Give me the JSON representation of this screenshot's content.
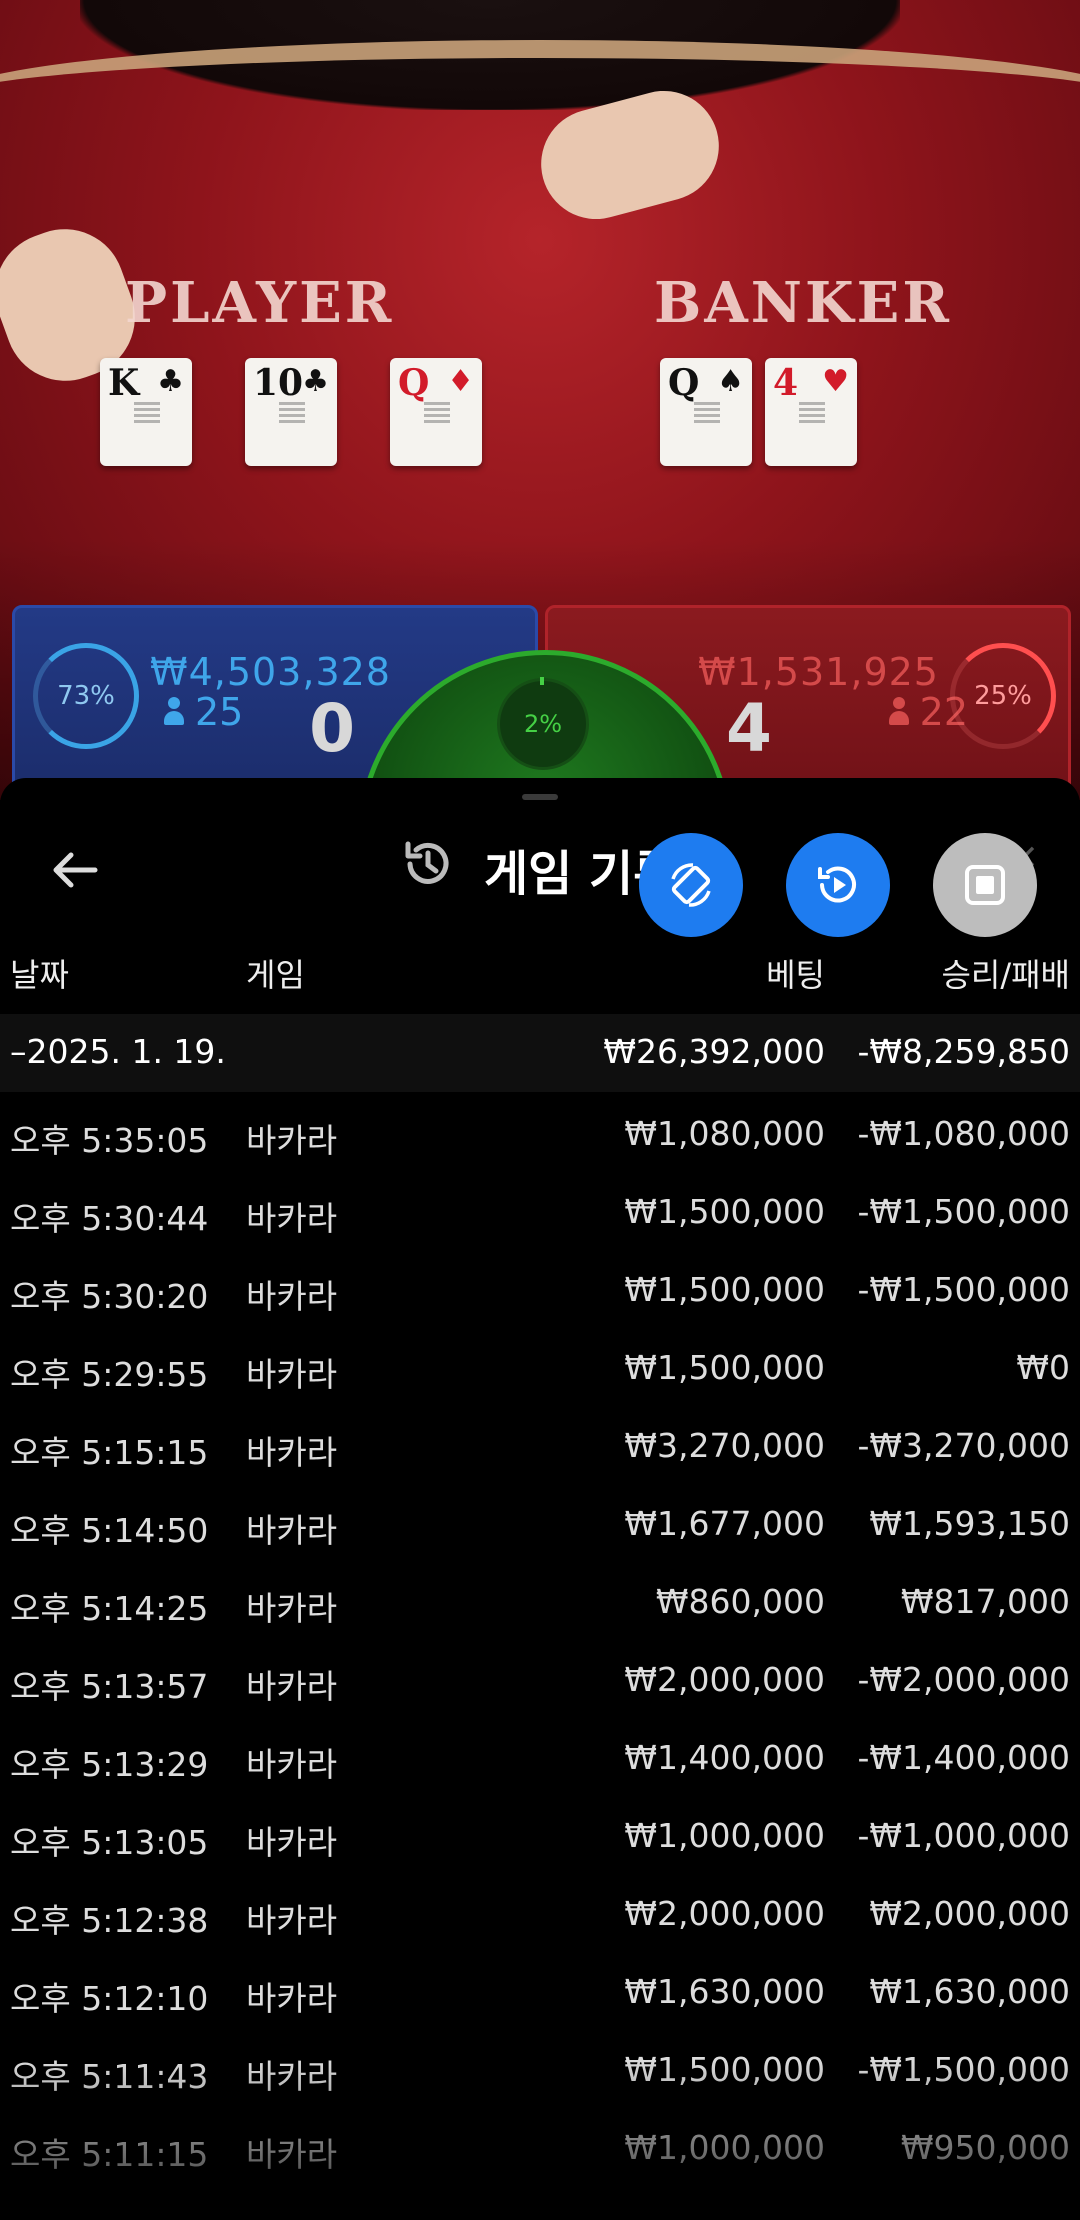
{
  "video": {
    "player_label": "PLAYER",
    "banker_label": "BANKER",
    "player_cards": [
      {
        "rank": "K",
        "suit": "♣",
        "color": "black"
      },
      {
        "rank": "10",
        "suit": "♣",
        "color": "black"
      },
      {
        "rank": "Q",
        "suit": "♦",
        "color": "red"
      }
    ],
    "banker_cards": [
      {
        "rank": "Q",
        "suit": "♠",
        "color": "black"
      },
      {
        "rank": "4",
        "suit": "♥",
        "color": "red"
      }
    ]
  },
  "bets": {
    "player": {
      "percent": "73%",
      "amount": "₩4,503,328",
      "count": "25",
      "score": "0",
      "color": "#3fa6ea"
    },
    "tie": {
      "percent": "2%",
      "color": "#45d045"
    },
    "banker": {
      "percent": "25%",
      "amount": "₩1,531,925",
      "count": "22",
      "score": "4",
      "color": "#d44a4a"
    }
  },
  "sheet": {
    "title": "게임 기록",
    "icons": {
      "back": "arrow-left-icon",
      "history": "history-clock-icon",
      "fab1": "rotate-screen-icon",
      "fab2": "replay-play-icon",
      "fab3": "stop-icon"
    },
    "columns": {
      "date": "날짜",
      "game": "게임",
      "bet": "베팅",
      "win": "승리/패배"
    },
    "summary": {
      "date": "–2025. 1. 19.",
      "bet": "₩26,392,000",
      "win": "-₩8,259,850"
    },
    "rows": [
      {
        "time": "오후 5:35:05",
        "game": "바카라",
        "bet": "₩1,080,000",
        "win": "-₩1,080,000"
      },
      {
        "time": "오후 5:30:44",
        "game": "바카라",
        "bet": "₩1,500,000",
        "win": "-₩1,500,000"
      },
      {
        "time": "오후 5:30:20",
        "game": "바카라",
        "bet": "₩1,500,000",
        "win": "-₩1,500,000"
      },
      {
        "time": "오후 5:29:55",
        "game": "바카라",
        "bet": "₩1,500,000",
        "win": "₩0"
      },
      {
        "time": "오후 5:15:15",
        "game": "바카라",
        "bet": "₩3,270,000",
        "win": "-₩3,270,000"
      },
      {
        "time": "오후 5:14:50",
        "game": "바카라",
        "bet": "₩1,677,000",
        "win": "₩1,593,150"
      },
      {
        "time": "오후 5:14:25",
        "game": "바카라",
        "bet": "₩860,000",
        "win": "₩817,000"
      },
      {
        "time": "오후 5:13:57",
        "game": "바카라",
        "bet": "₩2,000,000",
        "win": "-₩2,000,000"
      },
      {
        "time": "오후 5:13:29",
        "game": "바카라",
        "bet": "₩1,400,000",
        "win": "-₩1,400,000"
      },
      {
        "time": "오후 5:13:05",
        "game": "바카라",
        "bet": "₩1,000,000",
        "win": "-₩1,000,000"
      },
      {
        "time": "오후 5:12:38",
        "game": "바카라",
        "bet": "₩2,000,000",
        "win": "₩2,000,000"
      },
      {
        "time": "오후 5:12:10",
        "game": "바카라",
        "bet": "₩1,630,000",
        "win": "₩1,630,000"
      },
      {
        "time": "오후 5:11:43",
        "game": "바카라",
        "bet": "₩1,500,000",
        "win": "-₩1,500,000"
      },
      {
        "time": "오후 5:11:15",
        "game": "바카라",
        "bet": "₩1,000,000",
        "win": "₩950,000"
      }
    ]
  }
}
